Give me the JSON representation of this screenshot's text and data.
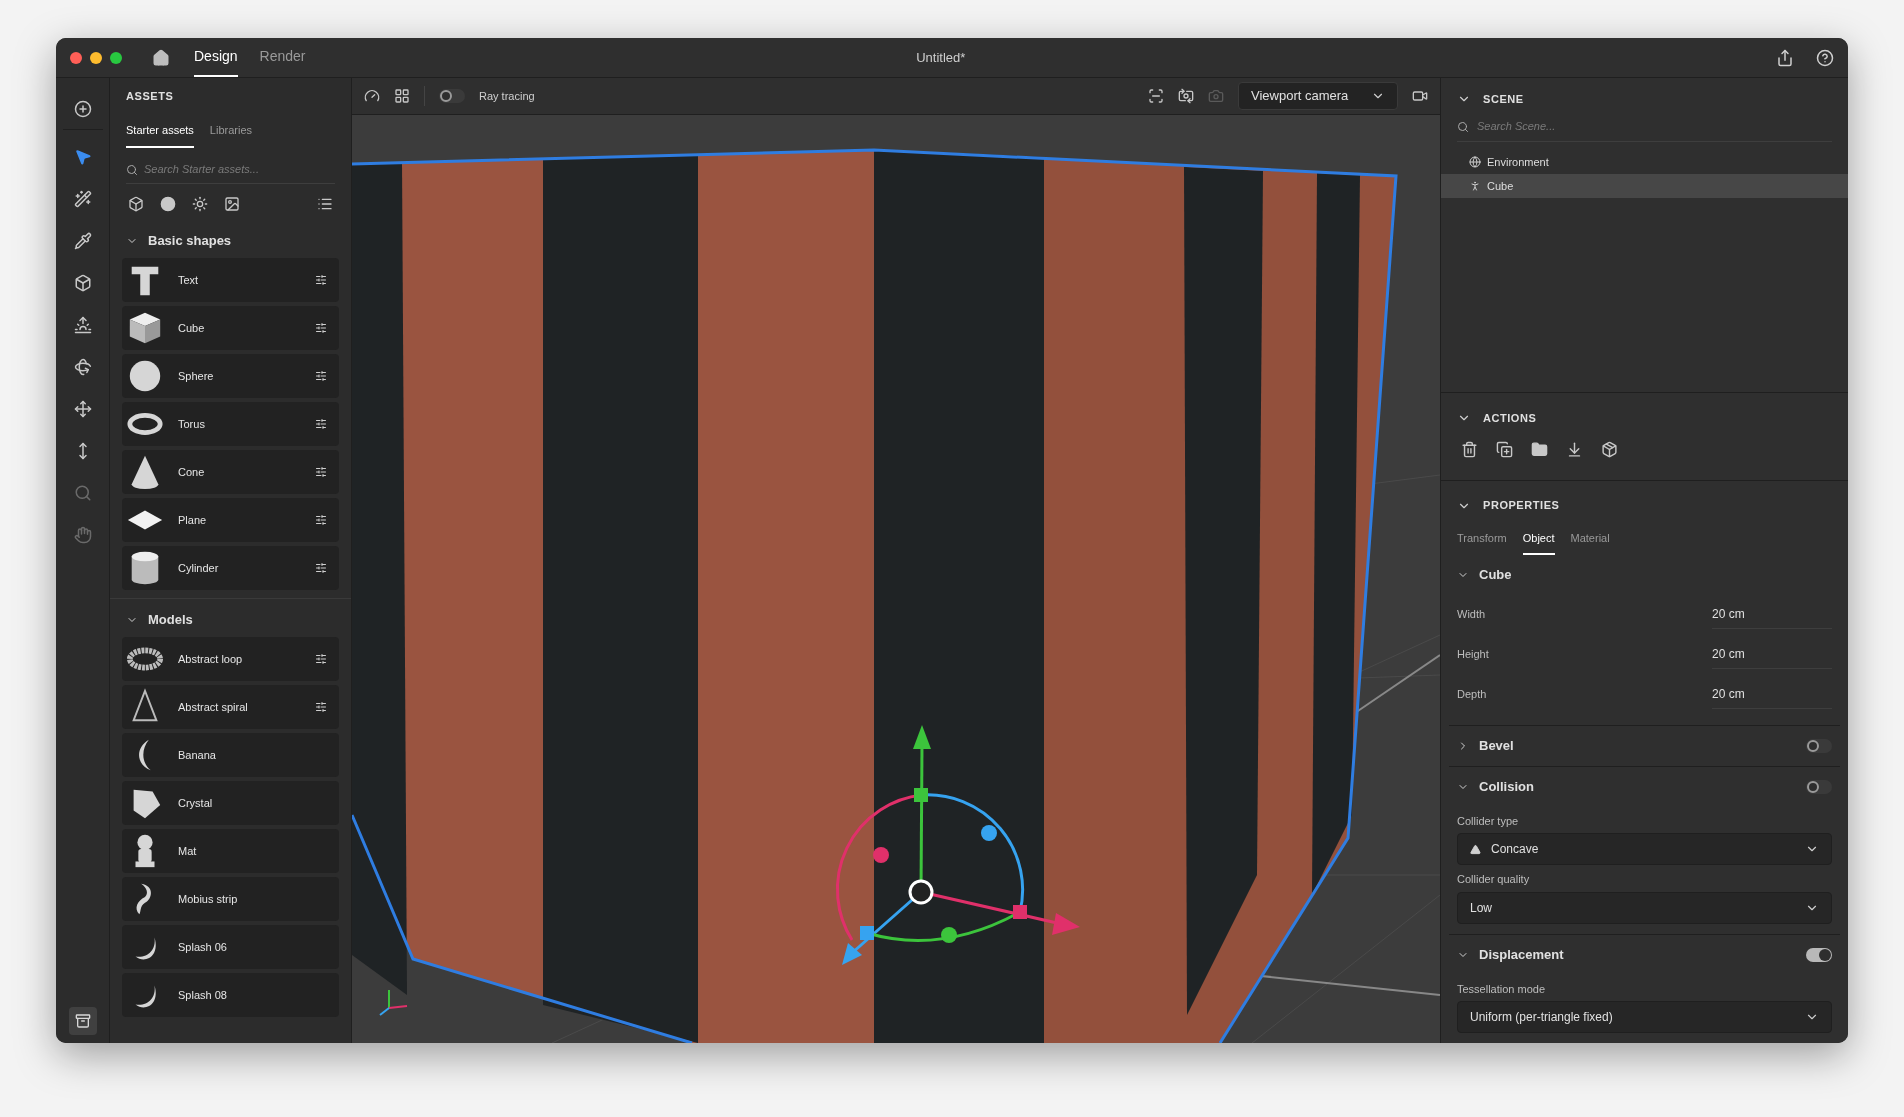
{
  "window": {
    "title": "Untitled*",
    "tabs": [
      {
        "label": "Design",
        "selected": true
      },
      {
        "label": "Render",
        "selected": false
      }
    ]
  },
  "tool_rail": {
    "tools": [
      {
        "kind": "add",
        "selected": false,
        "disabled": false
      },
      {
        "kind": "select",
        "selected": true,
        "disabled": false
      },
      {
        "kind": "magic",
        "selected": false,
        "disabled": false
      },
      {
        "kind": "eyedropper",
        "selected": false,
        "disabled": false
      },
      {
        "kind": "cube",
        "selected": false,
        "disabled": false
      },
      {
        "kind": "light",
        "selected": false,
        "disabled": false
      },
      {
        "kind": "orbit",
        "selected": false,
        "disabled": false
      },
      {
        "kind": "move",
        "selected": false,
        "disabled": false
      },
      {
        "kind": "drop",
        "selected": false,
        "disabled": false
      },
      {
        "kind": "zoom",
        "selected": false,
        "disabled": true
      },
      {
        "kind": "hand",
        "selected": false,
        "disabled": true
      }
    ]
  },
  "assets": {
    "title": "ASSETS",
    "tabs": [
      {
        "label": "Starter assets",
        "selected": true
      },
      {
        "label": "Libraries",
        "selected": false
      }
    ],
    "search": {
      "placeholder": "Search Starter assets..."
    },
    "sections": [
      {
        "title": "Basic shapes",
        "expanded": true,
        "items": [
          {
            "label": "Text",
            "kind": "text",
            "adjustable": true
          },
          {
            "label": "Cube",
            "kind": "cube",
            "adjustable": true
          },
          {
            "label": "Sphere",
            "kind": "sphere",
            "adjustable": true
          },
          {
            "label": "Torus",
            "kind": "torus",
            "adjustable": true
          },
          {
            "label": "Cone",
            "kind": "cone",
            "adjustable": true
          },
          {
            "label": "Plane",
            "kind": "plane",
            "adjustable": true
          },
          {
            "label": "Cylinder",
            "kind": "cylinder",
            "adjustable": true
          }
        ]
      },
      {
        "title": "Models",
        "expanded": true,
        "items": [
          {
            "label": "Abstract loop",
            "kind": "loop",
            "adjustable": true
          },
          {
            "label": "Abstract spiral",
            "kind": "spiral",
            "adjustable": true
          },
          {
            "label": "Banana",
            "kind": "banana",
            "adjustable": false
          },
          {
            "label": "Crystal",
            "kind": "crystal",
            "adjustable": false
          },
          {
            "label": "Mat",
            "kind": "figure",
            "adjustable": false
          },
          {
            "label": "Mobius strip",
            "kind": "mobius",
            "adjustable": false
          },
          {
            "label": "Splash 06",
            "kind": "splash",
            "adjustable": false
          },
          {
            "label": "Splash 08",
            "kind": "splash",
            "adjustable": false
          }
        ]
      }
    ]
  },
  "viewport": {
    "ray_tracing": {
      "label": "Ray tracing",
      "on": false
    },
    "camera_tools": [
      {
        "disabled": false
      },
      {
        "disabled": false
      },
      {
        "disabled": true
      }
    ],
    "camera": {
      "value": "Viewport camera"
    }
  },
  "scene": {
    "title": "SCENE",
    "expanded": true,
    "search": {
      "placeholder": "Search Scene..."
    },
    "items": [
      {
        "label": "Environment",
        "kind": "environment",
        "selected": false
      },
      {
        "label": "Cube",
        "kind": "object",
        "selected": true
      }
    ]
  },
  "actions": {
    "title": "ACTIONS",
    "expanded": true
  },
  "properties": {
    "title": "PROPERTIES",
    "expanded": true,
    "tabs": [
      {
        "label": "Transform",
        "selected": false
      },
      {
        "label": "Object",
        "selected": true
      },
      {
        "label": "Material",
        "selected": false
      }
    ],
    "groups": [
      {
        "title": "Cube",
        "expanded": true,
        "fields": [
          {
            "kind": "number",
            "label": "Width",
            "value": "20 cm"
          },
          {
            "kind": "number",
            "label": "Height",
            "value": "20 cm"
          },
          {
            "kind": "number",
            "label": "Depth",
            "value": "20 cm"
          }
        ]
      },
      {
        "title": "Bevel",
        "expanded": false,
        "on": false
      },
      {
        "title": "Collision",
        "expanded": true,
        "on": false,
        "fields": [
          {
            "kind": "iconselect",
            "label": "Collider type",
            "value": "Concave"
          },
          {
            "kind": "select",
            "label": "Collider quality",
            "value": "Low"
          }
        ]
      },
      {
        "title": "Displacement",
        "expanded": true,
        "on": true,
        "fields": [
          {
            "kind": "select",
            "label": "Tessellation mode",
            "value": "Uniform (per-triangle fixed)"
          }
        ]
      }
    ]
  }
}
